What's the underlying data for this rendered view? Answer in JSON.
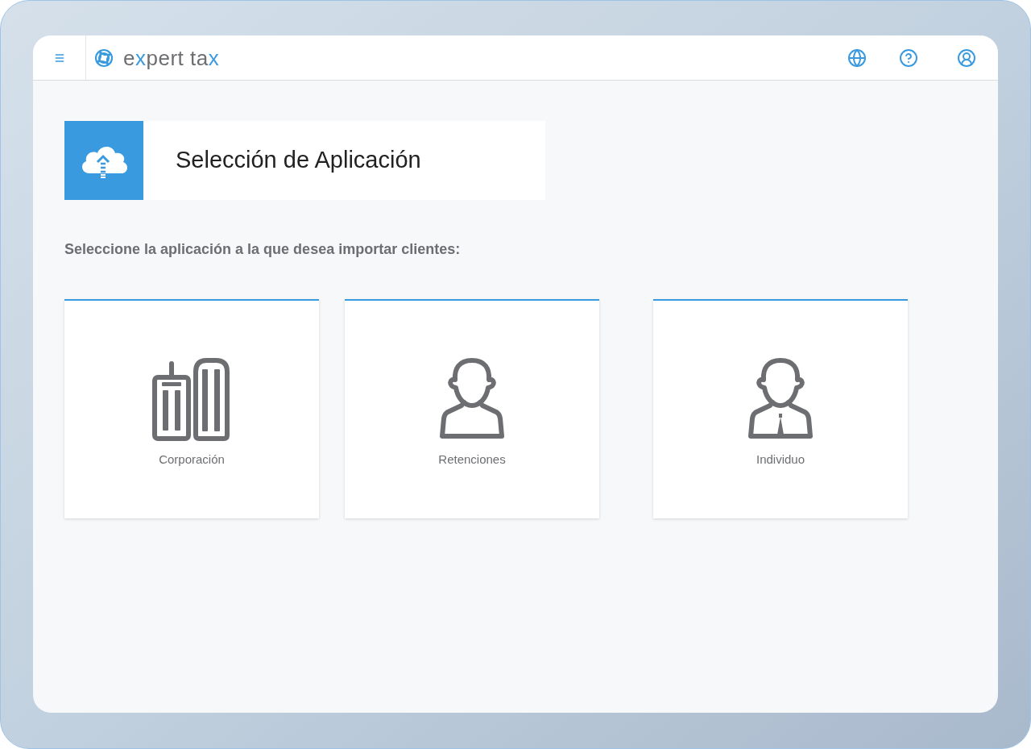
{
  "header": {
    "logo": [
      {
        "text": "e",
        "accent": false
      },
      {
        "text": "x",
        "accent": true
      },
      {
        "text": "pert ta",
        "accent": false
      },
      {
        "text": "x",
        "accent": true
      }
    ]
  },
  "page_title": "Selección de Aplicación",
  "instruction": "Seleccione la aplicación a la que desea importar clientes:",
  "applications": [
    {
      "kind": "corporation",
      "label": "Corporación"
    },
    {
      "kind": "person",
      "label": "Retenciones"
    },
    {
      "kind": "person-tie",
      "label": "Individuo"
    }
  ]
}
